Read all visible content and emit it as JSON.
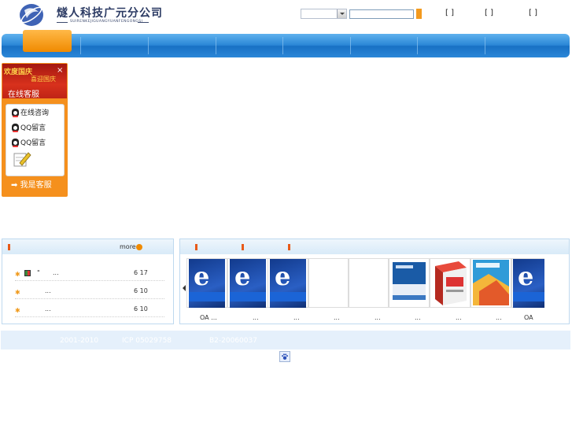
{
  "header": {
    "company_cn": "燧人科技广元分公司",
    "company_en": "SUIRENKEJIGUANGYUANFENGONGSI",
    "top_links": [
      "[ ]",
      "[ ]",
      "[ ]"
    ]
  },
  "nav": {
    "home_label": ""
  },
  "service": {
    "banner_line1": "欢度国庆",
    "banner_line2": "喜迎国庆",
    "banner_title": "在线客服",
    "close": "×",
    "items": [
      {
        "label": "在线咨询"
      },
      {
        "label": "QQ留言"
      },
      {
        "label": "QQ留言"
      }
    ],
    "footer_label": "我是客服"
  },
  "news": {
    "more_label": "more",
    "rows": [
      {
        "prefix": "\"",
        "title": "...",
        "date": "6 17"
      },
      {
        "prefix": "",
        "title": "...",
        "date": "6 10"
      },
      {
        "prefix": "",
        "title": "...",
        "date": "6 10"
      }
    ]
  },
  "products": {
    "captions": [
      "OA ...",
      "...",
      "...",
      "...",
      "...",
      "...",
      "...",
      "...",
      "OA"
    ]
  },
  "footer": {
    "copyright": "2001-2010",
    "icp": "ICP 05029758",
    "license": "B2-20060037"
  }
}
